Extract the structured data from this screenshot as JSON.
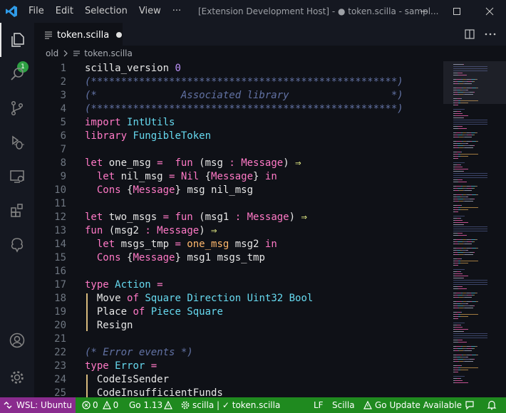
{
  "menu": {
    "items": [
      "File",
      "Edit",
      "Selection",
      "View",
      "···"
    ]
  },
  "window": {
    "title": "[Extension Development Host] - ● token.scilla - sampl..."
  },
  "activity": {
    "badge": "1"
  },
  "tab": {
    "label": "token.scilla"
  },
  "breadcrumb": {
    "folder": "old",
    "file": "token.scilla"
  },
  "editor": {
    "lines": [
      {
        "n": "1",
        "t": [
          [
            "t-ident",
            "scilla_version "
          ],
          [
            "t-num",
            "0"
          ]
        ]
      },
      {
        "n": "2",
        "t": [
          [
            "t-comment",
            "(***************************************************)"
          ]
        ]
      },
      {
        "n": "3",
        "t": [
          [
            "t-comment",
            "(*              Associated library                 *)"
          ]
        ]
      },
      {
        "n": "4",
        "t": [
          [
            "t-comment",
            "(***************************************************)"
          ]
        ]
      },
      {
        "n": "5",
        "t": [
          [
            "t-kw",
            "import "
          ],
          [
            "t-type",
            "IntUtils"
          ]
        ]
      },
      {
        "n": "6",
        "t": [
          [
            "t-kw",
            "library "
          ],
          [
            "t-type",
            "FungibleToken"
          ]
        ]
      },
      {
        "n": "7",
        "t": []
      },
      {
        "n": "8",
        "t": [
          [
            "t-kw",
            "let "
          ],
          [
            "t-ident",
            "one_msg "
          ],
          [
            "t-kw",
            "= "
          ],
          [
            "t-kw",
            " fun "
          ],
          [
            "t-plain",
            "("
          ],
          [
            "t-ident",
            "msg "
          ],
          [
            "t-kw",
            ": "
          ],
          [
            "t-kw",
            "Message"
          ],
          [
            "t-plain",
            ") "
          ],
          [
            "t-op",
            "⇒"
          ]
        ]
      },
      {
        "n": "9",
        "t": [
          [
            "t-plain",
            "  "
          ],
          [
            "t-kw",
            "let "
          ],
          [
            "t-ident",
            "nil_msg "
          ],
          [
            "t-kw",
            "= "
          ],
          [
            "t-kw",
            "Nil "
          ],
          [
            "t-brace",
            "{"
          ],
          [
            "t-kw",
            "Message"
          ],
          [
            "t-brace",
            "} "
          ],
          [
            "t-kw",
            "in"
          ]
        ]
      },
      {
        "n": "10",
        "t": [
          [
            "t-plain",
            "  "
          ],
          [
            "t-kw",
            "Cons "
          ],
          [
            "t-brace",
            "{"
          ],
          [
            "t-kw",
            "Message"
          ],
          [
            "t-brace",
            "} "
          ],
          [
            "t-ident",
            "msg nil_msg"
          ]
        ]
      },
      {
        "n": "11",
        "t": []
      },
      {
        "n": "12",
        "t": [
          [
            "t-kw",
            "let "
          ],
          [
            "t-ident",
            "two_msgs "
          ],
          [
            "t-kw",
            "= "
          ],
          [
            "t-kw",
            "fun "
          ],
          [
            "t-plain",
            "("
          ],
          [
            "t-ident",
            "msg1 "
          ],
          [
            "t-kw",
            ": "
          ],
          [
            "t-kw",
            "Message"
          ],
          [
            "t-plain",
            ") "
          ],
          [
            "t-op",
            "⇒"
          ]
        ]
      },
      {
        "n": "13",
        "t": [
          [
            "t-kw",
            "fun "
          ],
          [
            "t-plain",
            "("
          ],
          [
            "t-ident",
            "msg2 "
          ],
          [
            "t-kw",
            ": "
          ],
          [
            "t-kw",
            "Message"
          ],
          [
            "t-plain",
            ") "
          ],
          [
            "t-op",
            "⇒"
          ]
        ]
      },
      {
        "n": "14",
        "t": [
          [
            "t-plain",
            "  "
          ],
          [
            "t-kw",
            "let "
          ],
          [
            "t-ident",
            "msgs_tmp "
          ],
          [
            "t-kw",
            "= "
          ],
          [
            "t-fn",
            "one_msg "
          ],
          [
            "t-ident",
            "msg2 "
          ],
          [
            "t-kw",
            "in"
          ]
        ]
      },
      {
        "n": "15",
        "t": [
          [
            "t-plain",
            "  "
          ],
          [
            "t-kw",
            "Cons "
          ],
          [
            "t-brace",
            "{"
          ],
          [
            "t-kw",
            "Message"
          ],
          [
            "t-brace",
            "} "
          ],
          [
            "t-ident",
            "msg1 msgs_tmp"
          ]
        ]
      },
      {
        "n": "16",
        "t": []
      },
      {
        "n": "17",
        "t": [
          [
            "t-kw",
            "type "
          ],
          [
            "t-type",
            "Action "
          ],
          [
            "t-kw",
            "="
          ]
        ]
      },
      {
        "n": "18",
        "t": [
          [
            "t-plain",
            "  "
          ],
          [
            "t-ident",
            "Move "
          ],
          [
            "t-kw",
            "of "
          ],
          [
            "t-type",
            "Square Direction Uint32 Bool"
          ]
        ]
      },
      {
        "n": "19",
        "t": [
          [
            "t-plain",
            "  "
          ],
          [
            "t-ident",
            "Place "
          ],
          [
            "t-kw",
            "of "
          ],
          [
            "t-type",
            "Piece Square"
          ]
        ]
      },
      {
        "n": "20",
        "t": [
          [
            "t-plain",
            "  "
          ],
          [
            "t-ident",
            "Resign"
          ]
        ]
      },
      {
        "n": "21",
        "t": []
      },
      {
        "n": "22",
        "t": [
          [
            "t-comment",
            "(* Error events *)"
          ]
        ]
      },
      {
        "n": "23",
        "t": [
          [
            "t-kw",
            "type "
          ],
          [
            "t-type",
            "Error "
          ],
          [
            "t-kw",
            "="
          ]
        ]
      },
      {
        "n": "24",
        "t": [
          [
            "t-plain",
            "  "
          ],
          [
            "t-ident",
            "CodeIsSender"
          ]
        ]
      },
      {
        "n": "25",
        "t": [
          [
            "t-plain",
            "  "
          ],
          [
            "t-ident",
            "CodeInsufficientFunds"
          ]
        ]
      }
    ]
  },
  "status": {
    "remote": "WSL: Ubuntu",
    "errors": "0",
    "warnings": "0",
    "go": "Go 1.13",
    "lang_server": "scilla | ✓ token.scilla",
    "eol": "LF",
    "language": "Scilla",
    "update": "Go Update Available"
  },
  "colors": {
    "accent_green": "#1f8a1f",
    "remote_purple": "#8a2b8e",
    "badge_green": "#2ea043"
  },
  "icons": [
    "vscode-logo-icon",
    "files-icon",
    "search-icon",
    "source-control-icon",
    "debug-icon",
    "remote-explorer-icon",
    "extensions-icon",
    "tree-icon",
    "account-icon",
    "settings-gear-icon",
    "split-editor-icon",
    "more-icon",
    "minimize-icon",
    "maximize-icon",
    "close-icon",
    "remote-icon",
    "error-icon",
    "warning-icon",
    "bell-icon",
    "feedback-icon"
  ]
}
